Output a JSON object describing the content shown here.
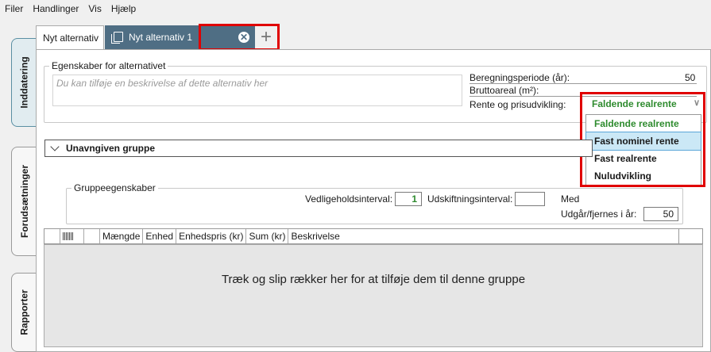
{
  "menu": [
    "Filer",
    "Handlinger",
    "Vis",
    "Hjælp"
  ],
  "sidetabs": {
    "input": "Inddatering",
    "assumptions": "Forudsætninger",
    "reports": "Rapporter"
  },
  "tabs": {
    "first": "Nyt alternativ",
    "second": "Nyt alternativ 1",
    "close": "✕",
    "add": "+"
  },
  "properties": {
    "legend": "Egenskaber for alternativet",
    "description_placeholder": "Du kan tilføje en beskrivelse af dette alternativ her",
    "calc_period_label": "Beregningsperiode (år):",
    "calc_period_value": "50",
    "gross_area_label": "Bruttoareal (m²):",
    "interest_label": "Rente og prisudvikling:",
    "interest_selected": "Faldende realrente"
  },
  "dropdown_options": [
    "Faldende realrente",
    "Fast nominel rente",
    "Fast realrente",
    "Nuludvikling"
  ],
  "group": {
    "name": "Unavngiven gruppe",
    "legend": "Gruppeegenskaber",
    "maintenance_label": "Vedligeholdsinterval:",
    "maintenance_value": "1",
    "replace_label": "Udskiftningsinterval:",
    "replace_value": "",
    "truncated_label": "Med",
    "expires_label": "Udgår/fjernes i år:",
    "expires_value": "50"
  },
  "grid": {
    "columns": [
      "Mængde",
      "Enhed",
      "Enhedspris (kr)",
      "Sum (kr)",
      "Beskrivelse"
    ],
    "empty_message": "Træk og slip rækker her for at tilføje dem til denne gruppe"
  },
  "colors": {
    "accent_green": "#2e8b2e",
    "tab_active": "#4f6e84",
    "highlight_red": "#e00000",
    "selection_blue": "#cbe8f6"
  }
}
